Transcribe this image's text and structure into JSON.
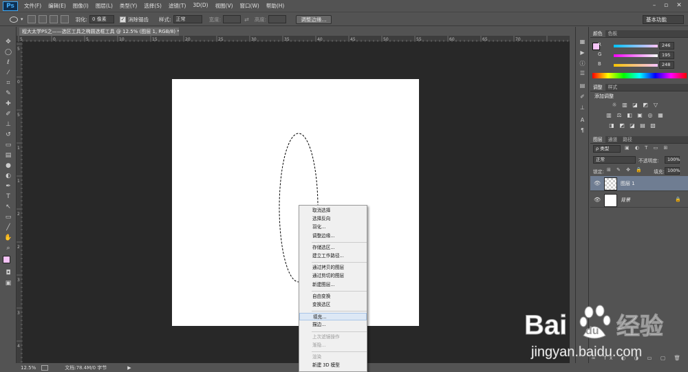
{
  "app": {
    "logo": "Ps"
  },
  "menu": [
    "文件(F)",
    "编辑(E)",
    "图像(I)",
    "图层(L)",
    "类型(Y)",
    "选择(S)",
    "滤镜(T)",
    "3D(D)",
    "视图(V)",
    "窗口(W)",
    "帮助(H)"
  ],
  "options": {
    "feather_label": "羽化:",
    "feather_value": "0 像素",
    "antialias_label": "消除锯齿",
    "style_label": "样式:",
    "style_value": "正常",
    "width_label": "宽度:",
    "height_label": "高度:",
    "refine_edge": "调整边缘...",
    "workspace": "基本功能"
  },
  "document": {
    "tab_title": "程大太学PS之——选区工具之椭圆选框工具 @ 12.5% (图层 1, RGB/8) *",
    "zoom": "12.5%",
    "doc_info": "文档:78.4M/0 字节"
  },
  "ruler_h_ticks": [
    "5",
    "0",
    "5",
    "10",
    "15",
    "20",
    "25",
    "30",
    "35",
    "40",
    "45",
    "50",
    "55",
    "60",
    "65",
    "70"
  ],
  "ruler_v_ticks": [
    "5",
    "0",
    "5",
    "1",
    "1",
    "2",
    "2",
    "3",
    "3",
    "4"
  ],
  "context_menu": {
    "items": [
      {
        "label": "取消选择",
        "disabled": false
      },
      {
        "label": "选择反向",
        "disabled": false
      },
      {
        "label": "羽化...",
        "disabled": false
      },
      {
        "label": "调整边缘...",
        "disabled": false
      },
      {
        "label": "存储选区...",
        "disabled": false
      },
      {
        "label": "建立工作路径...",
        "disabled": false
      },
      {
        "label": "通过拷贝的图层",
        "disabled": false
      },
      {
        "label": "通过剪切的图层",
        "disabled": false
      },
      {
        "label": "新建图层...",
        "disabled": false
      },
      {
        "label": "自由变换",
        "disabled": false
      },
      {
        "label": "变换选区",
        "disabled": false
      },
      {
        "label": "填充...",
        "disabled": false,
        "highlighted": true
      },
      {
        "label": "描边...",
        "disabled": false
      },
      {
        "label": "上次滤镜操作",
        "disabled": true
      },
      {
        "label": "渐隐...",
        "disabled": true
      },
      {
        "label": "渲染",
        "disabled": true
      },
      {
        "label": "新建 3D 模型",
        "disabled": false
      }
    ]
  },
  "color_panel": {
    "tabs": [
      "颜色",
      "色板"
    ],
    "r_label": "R",
    "r_value": "246",
    "g_label": "G",
    "g_value": "195",
    "b_label": "B",
    "b_value": "248",
    "foreground": "#f6c3f8"
  },
  "adjust_panel": {
    "tabs": [
      "调整",
      "样式"
    ],
    "title": "添加调整"
  },
  "layers_panel": {
    "tabs": [
      "图层",
      "通道",
      "路径"
    ],
    "filter_label": "ρ 类型",
    "blend_mode": "正常",
    "opacity_label": "不透明度:",
    "opacity_value": "100%",
    "lock_label": "锁定:",
    "fill_label": "填充:",
    "fill_value": "100%",
    "layers": [
      {
        "name": "图层 1",
        "selected": true
      },
      {
        "name": "背景",
        "selected": false,
        "locked": true
      }
    ]
  },
  "watermark": {
    "brand": "Bai",
    "brand2": "du",
    "cn": "经验",
    "url": "jingyan.baidu.com"
  }
}
